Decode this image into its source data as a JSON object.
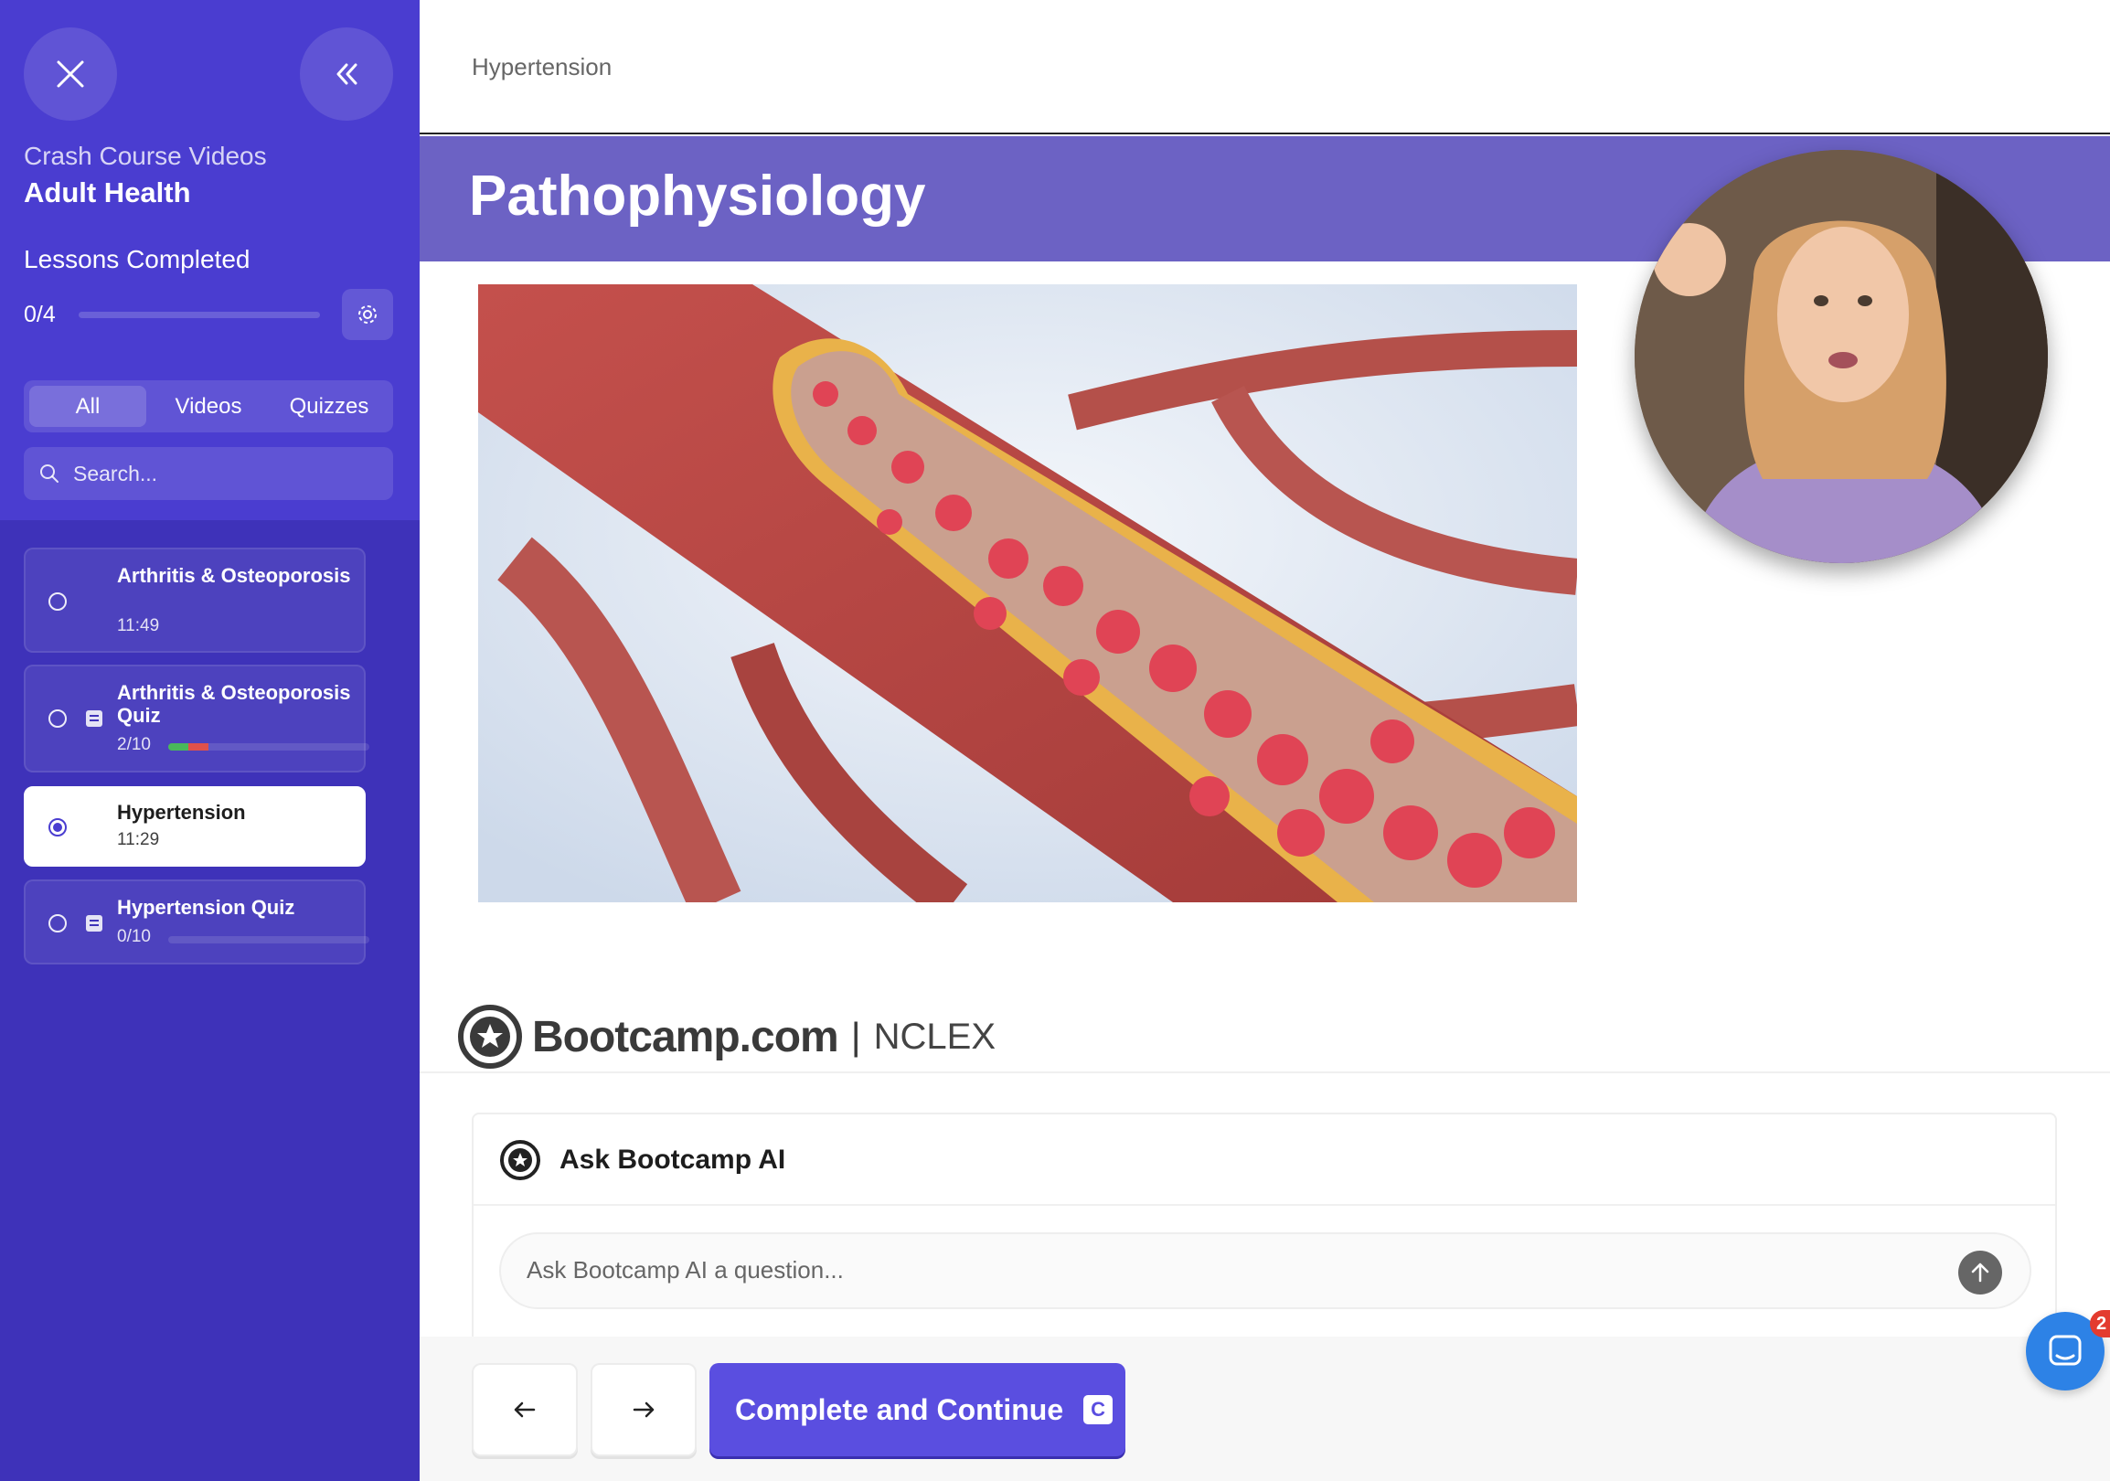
{
  "sidebar": {
    "course_category": "Crash Course Videos",
    "course_title": "Adult Health",
    "lessons_completed_label": "Lessons Completed",
    "lessons_completed_value": "0/4",
    "lessons_progress": 0,
    "filter_tabs": [
      {
        "label": "All",
        "active": true
      },
      {
        "label": "Videos",
        "active": false
      },
      {
        "label": "Quizzes",
        "active": false
      }
    ],
    "search_placeholder": "Search...",
    "lessons": [
      {
        "title": "Arthritis & Osteoporosis",
        "meta": "11:49",
        "type": "video",
        "active": false
      },
      {
        "title": "Arthritis & Osteoporosis Quiz",
        "meta": "2/10",
        "type": "quiz",
        "active": false,
        "quiz_correct_fraction": 0.1,
        "quiz_wrong_fraction": 0.1
      },
      {
        "title": "Hypertension",
        "meta": "11:29",
        "type": "video",
        "active": true
      },
      {
        "title": "Hypertension Quiz",
        "meta": "0/10",
        "type": "quiz",
        "active": false,
        "quiz_correct_fraction": 0,
        "quiz_wrong_fraction": 0
      }
    ]
  },
  "main": {
    "breadcrumb": "Hypertension",
    "slide_title": "Pathophysiology",
    "brand_name": "Bootcamp.com",
    "brand_separator": "|",
    "brand_subtitle": "NCLEX"
  },
  "ai": {
    "title": "Ask Bootcamp AI",
    "input_placeholder": "Ask Bootcamp AI a question..."
  },
  "footer": {
    "complete_label": "Complete and Continue",
    "complete_shortcut": "C"
  },
  "chat": {
    "badge_count": "2"
  },
  "colors": {
    "sidebar_accent": "#4a3dd0",
    "sidebar_bg": "#3e32b9",
    "banner": "#6c62c4",
    "primary_button": "#5a4ee0",
    "chat_launcher": "#2d82e6"
  }
}
